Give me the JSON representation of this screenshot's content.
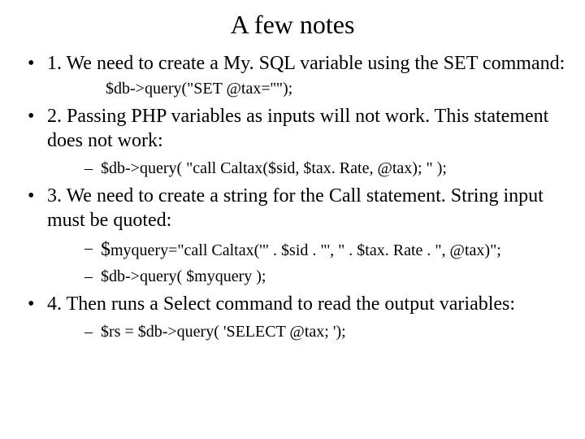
{
  "title": "A few notes",
  "items": [
    {
      "text": "1. We need to create a My. SQL variable using the SET command:",
      "plain": "$db->query(\"SET @tax=''\");"
    },
    {
      "text": "2. Passing PHP variables as inputs will not work. This statement does not work:",
      "sub": [
        "$db->query( \"call Caltax($sid, $tax. Rate, @tax); \" );"
      ]
    },
    {
      "text": "3. We need to create a string for the Call statement. String input must be quoted:",
      "sub_dollar": [
        {
          "dollar": "$",
          "rest": "myquery=\"call Caltax('\" . $sid . \"', \" . $tax. Rate . \", @tax)\";"
        },
        {
          "dollar": "",
          "rest": "$db->query( $myquery );"
        }
      ]
    },
    {
      "text": "4. Then runs a Select command to read the output variables:",
      "sub": [
        "$rs = $db->query( 'SELECT @tax; ');"
      ]
    }
  ]
}
